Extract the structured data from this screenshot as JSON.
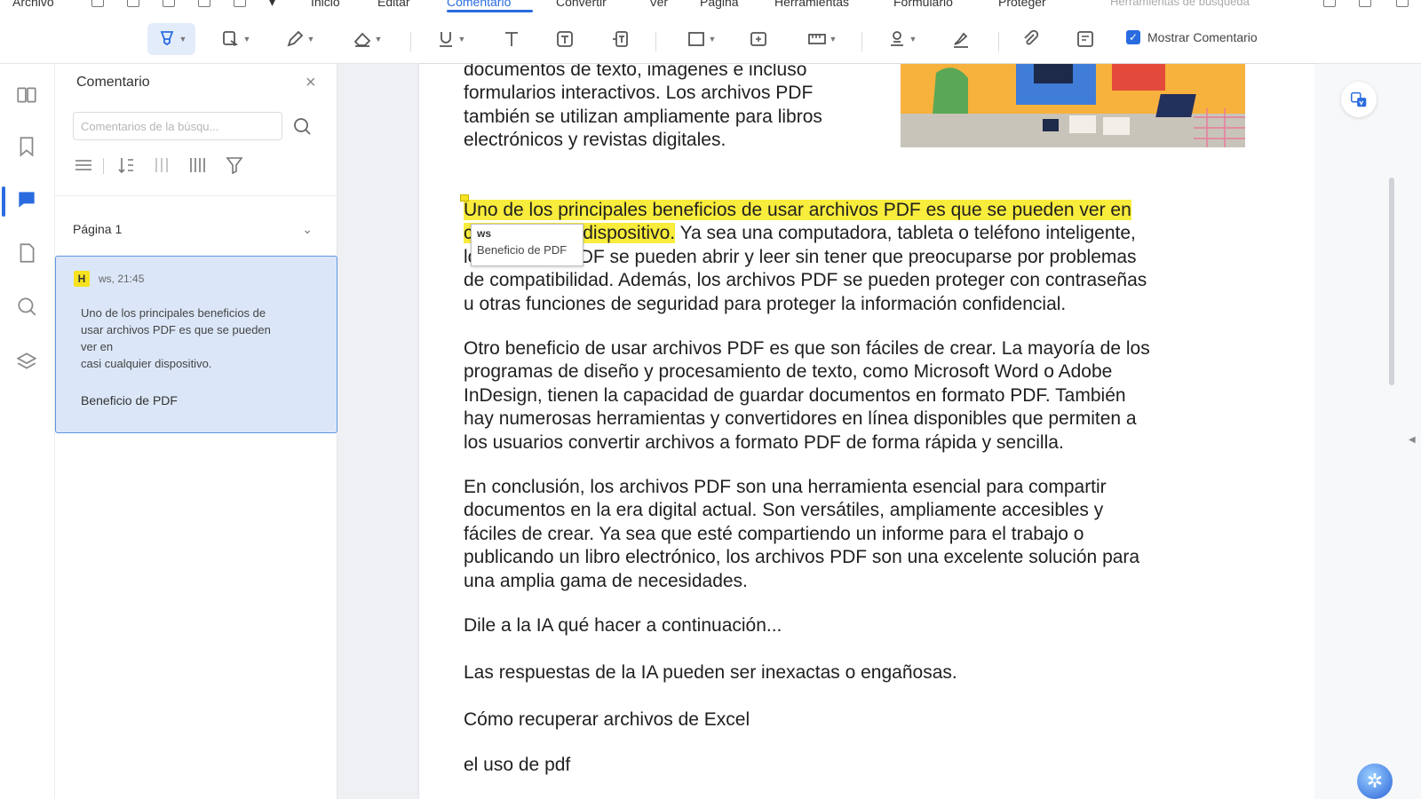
{
  "menu": {
    "items": [
      {
        "label": "Archivo",
        "active": false
      },
      {
        "label": "Inicio",
        "active": false
      },
      {
        "label": "Editar",
        "active": false
      },
      {
        "label": "Comentario",
        "active": true
      },
      {
        "label": "Convertir",
        "active": false
      },
      {
        "label": "Ver",
        "active": false
      },
      {
        "label": "Página",
        "active": false
      },
      {
        "label": "Herramientas",
        "active": false
      },
      {
        "label": "Formulario",
        "active": false
      },
      {
        "label": "Proteger",
        "active": false
      }
    ],
    "search_hint": "Herramientas de búsqueda"
  },
  "toolbar": {
    "show_comment_label": "Mostrar Comentario",
    "show_comment_checked": true
  },
  "panel": {
    "title": "Comentario",
    "search_placeholder": "Comentarios de la búsqu...",
    "page_group": "Página 1",
    "comment": {
      "type_badge": "H",
      "meta": "ws, 21:45",
      "quote_lines": [
        "Uno de los principales beneficios de",
        "usar archivos PDF es que se pueden",
        "ver en",
        "casi cualquier dispositivo."
      ],
      "note": "Beneficio de PDF"
    }
  },
  "document": {
    "intro_lines": [
      "documentos de texto, imágenes e incluso",
      "formularios interactivos. Los archivos PDF",
      "también se utilizan ampliamente para libros",
      "electrónicos y revistas digitales."
    ],
    "para1": {
      "line1_highlight": "Uno de los principales beneficios de usar archivos PDF es que se pueden ver en",
      "line2_prefix_highlight": "casi cualquier dispositivo.",
      "line2_rest": " Ya sea una computadora, tableta o teléfono inteligente,",
      "line3": "los archivos PDF se pueden abrir y leer sin tener que preocuparse por problemas",
      "line4": "de compatibilidad. Además, los archivos PDF se pueden proteger con contraseñas",
      "line5": "u otras funciones de seguridad para proteger la información confidencial."
    },
    "para2_lines": [
      "Otro beneficio de usar archivos PDF es que son fáciles de crear. La mayoría de los",
      "programas de diseño y procesamiento de texto, como Microsoft Word o Adobe",
      "InDesign, tienen la capacidad de guardar documentos en formato PDF. También",
      "hay numerosas herramientas y convertidores en línea disponibles que permiten a",
      "los usuarios convertir archivos a formato PDF de forma rápida y sencilla."
    ],
    "para3_lines": [
      "En conclusión, los archivos PDF son una herramienta esencial para compartir",
      "documentos en la era digital actual. Son versátiles, ampliamente accesibles y",
      "fáciles de crear. Ya sea que esté compartiendo un informe para el trabajo o",
      "publicando un libro electrónico, los archivos PDF son una excelente solución para",
      "una amplia gama de necesidades."
    ],
    "line_ai_prompt": "Dile a la IA qué hacer a continuación...",
    "line_ai_warning": "Las respuestas de la IA pueden ser inexactas o engañosas.",
    "line_excel": "Cómo recuperar archivos de Excel",
    "line_pdf_use": "el uso de pdf",
    "tooltip": {
      "author": "ws",
      "note": "Beneficio de PDF"
    }
  },
  "colors": {
    "accent": "#2a6ce0",
    "highlight": "#f8ec3c",
    "card_bg": "#dbe7f8"
  }
}
